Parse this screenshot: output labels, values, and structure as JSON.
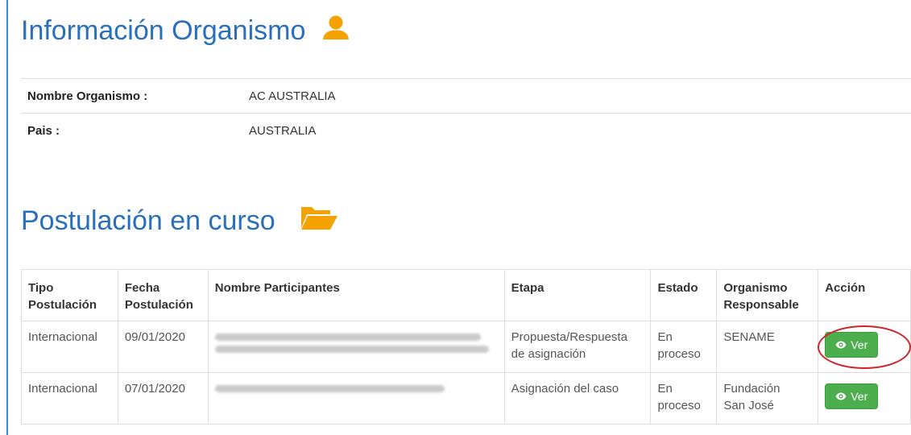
{
  "info_section": {
    "title": "Información Organismo",
    "icon": "user-icon",
    "accent_color": "#f5a200",
    "fields": [
      {
        "label": "Nombre Organismo :",
        "value": "AC AUSTRALIA"
      },
      {
        "label": "Pais :",
        "value": "AUSTRALIA"
      }
    ]
  },
  "postulation_section": {
    "title": "Postulación en curso",
    "icon": "folder-open-icon",
    "columns": [
      [
        "Tipo",
        "Postulación"
      ],
      [
        "Fecha",
        "Postulación"
      ],
      [
        "Nombre Participantes"
      ],
      [
        "Etapa"
      ],
      [
        "Estado"
      ],
      [
        "Organismo",
        "Responsable"
      ],
      [
        "Acción"
      ]
    ],
    "rows": [
      {
        "tipo": "Internacional",
        "fecha": "09/01/2020",
        "participantes": "redacted",
        "etapa": [
          "Propuesta/Respuesta",
          "de asignación"
        ],
        "estado": [
          "En",
          "proceso"
        ],
        "organismo": [
          "SENAME"
        ],
        "accion": "Ver",
        "highlighted": true
      },
      {
        "tipo": "Internacional",
        "fecha": "07/01/2020",
        "participantes": "redacted",
        "etapa": [
          "Asignación del caso"
        ],
        "estado": [
          "En",
          "proceso"
        ],
        "organismo": [
          "Fundación",
          "San José"
        ],
        "accion": "Ver",
        "highlighted": false
      }
    ]
  },
  "colors": {
    "title": "#2a6fba",
    "button": "#4cae4c",
    "highlight": "#d0232a",
    "left_rule": "#3a88d8"
  }
}
